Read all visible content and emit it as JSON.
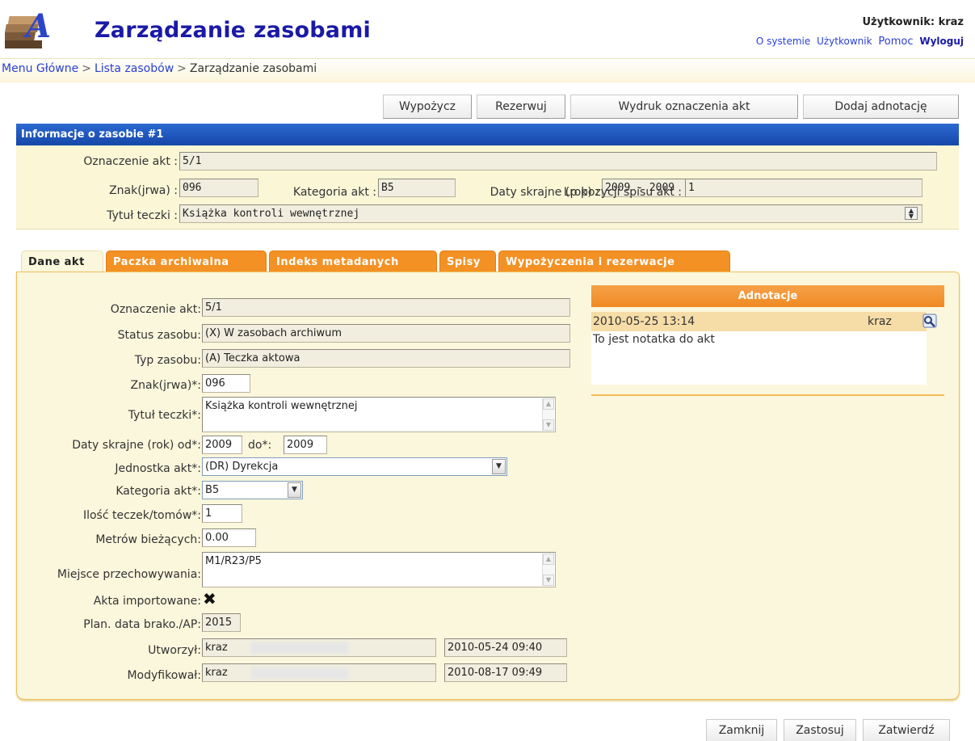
{
  "header": {
    "title": "Zarządzanie zasobami",
    "user_line": "Użytkownik: kraz",
    "links": [
      "O systemie",
      "Użytkownik",
      "Pomoc",
      "Wyloguj"
    ]
  },
  "breadcrumb": [
    "Menu Główne",
    "Lista zasobów",
    "Zarządzanie zasobami"
  ],
  "toolbar": [
    "Wypożycz",
    "Rezerwuj",
    "Wydruk oznaczenia akt",
    "Dodaj adnotację"
  ],
  "info": {
    "heading": "Informacje o zasobie #1",
    "oznaczenie_label": "Oznaczenie akt :",
    "oznaczenie_value": "5/1",
    "znak_label": "Znak(jrwa) :",
    "znak_value": "096",
    "kategoria_label": "Kategoria akt :",
    "kategoria_value": "B5",
    "daty_label": "Daty skrajne (rok) :",
    "daty_value": "2009 - 2009",
    "lp_label": "Lp pozycji spisu akt :",
    "lp_value": "1",
    "tytul_label": "Tytuł teczki :",
    "tytul_value": "Książka kontroli wewnętrznej"
  },
  "tabs": [
    "Dane akt",
    "Paczka archiwalna",
    "Indeks metadanych",
    "Spisy",
    "Wypożyczenia i rezerwacje"
  ],
  "form": {
    "oznaczenie_label": "Oznaczenie akt:",
    "oznaczenie_value": "5/1",
    "status_label": "Status zasobu:",
    "status_value": "(X) W zasobach archiwum",
    "typ_label": "Typ zasobu:",
    "typ_value": "(A) Teczka aktowa",
    "znak_label": "Znak(jrwa)*:",
    "znak_value": "096",
    "tytul_label": "Tytuł teczki*:",
    "tytul_value": "Książka kontroli wewnętrznej",
    "daty_label": "Daty skrajne (rok) od*:",
    "daty_od": "2009",
    "daty_do_label": "do*:",
    "daty_do": "2009",
    "jednostka_label": "Jednostka akt*:",
    "jednostka_value": "(DR) Dyrekcja",
    "kategoria_label": "Kategoria akt*:",
    "kategoria_value": "B5",
    "ilosc_label": "Ilość teczek/tomów*:",
    "ilosc_value": "1",
    "metrow_label": "Metrów bieżących:",
    "metrow_value": "0.00",
    "miejsce_label": "Miejsce przechowywania:",
    "miejsce_value": "M1/R23/P5",
    "importowane_label": "Akta importowane:",
    "importowane_mark": "✖",
    "plan_label": "Plan. data brako./AP:",
    "plan_value": "2015",
    "utworzyl_label": "Utworzył:",
    "utworzyl_user": "kraz",
    "utworzyl_date": "2010-05-24 09:40",
    "modyfikowal_label": "Modyfikował:",
    "modyfikowal_user": "kraz",
    "modyfikowal_date": "2010-08-17 09:49"
  },
  "annotations": {
    "heading": "Adnotacje",
    "date": "2010-05-25 13:14",
    "user": "kraz",
    "text": "To jest notatka do akt"
  },
  "footer_buttons": [
    "Zamknij",
    "Zastosuj",
    "Zatwierdź"
  ],
  "colors": {
    "title_blue": "#1a1aa6",
    "link_blue": "#2a3fd4",
    "panel_header_blue": "#1646a8",
    "tab_orange": "#f39124",
    "panel_cream": "#fbf7dc"
  }
}
